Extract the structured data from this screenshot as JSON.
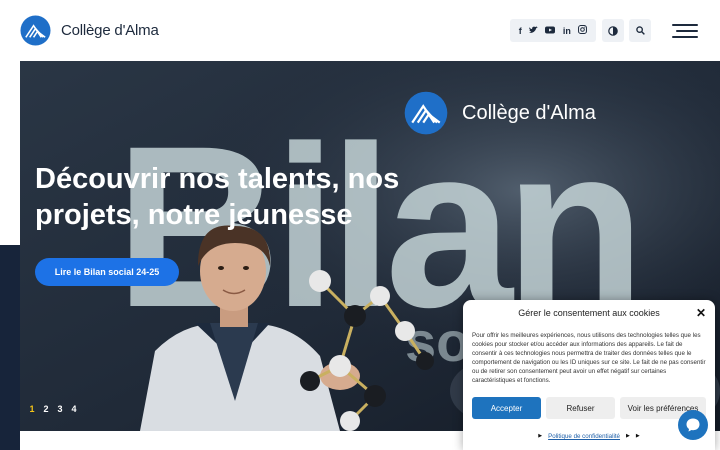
{
  "header": {
    "logo_text": "Collège d'Alma",
    "social": [
      {
        "icon": "facebook-icon",
        "glyph": "f"
      },
      {
        "icon": "twitter-icon",
        "glyph": "🐦"
      },
      {
        "icon": "youtube-icon",
        "glyph": "▶"
      },
      {
        "icon": "linkedin-icon",
        "glyph": "in"
      },
      {
        "icon": "instagram-icon",
        "glyph": "◎"
      }
    ],
    "contrast_icon": "contrast-icon",
    "search_icon": "search-icon",
    "menu_icon": "hamburger-menu-icon"
  },
  "hero": {
    "background_word": "Bilan",
    "brand_overlay": "Collège d'Alma",
    "title": "Découvrir nos talents, nos projets, notre jeunesse",
    "cta_label": "Lire le Bilan social 24-25",
    "slides": [
      "1",
      "2",
      "3",
      "4"
    ],
    "active_slide": "1"
  },
  "cookie": {
    "title": "Gérer le consentement aux cookies",
    "body": "Pour offrir les meilleures expériences, nous utilisons des technologies telles que les cookies pour stocker et/ou accéder aux informations des appareils. Le fait de consentir à ces technologies nous permettra de traiter des données telles que le comportement de navigation ou les ID uniques sur ce site. Le fait de ne pas consentir ou de retirer son consentement peut avoir un effet négatif sur certaines caractéristiques et fonctions.",
    "accept": "Accepter",
    "refuse": "Refuser",
    "preferences": "Voir les préférences",
    "policy_link": "Politique de confidentialité"
  },
  "colors": {
    "accent": "#1d72e6",
    "navy": "#1d2a3d",
    "active_slide": "#f5c518"
  }
}
